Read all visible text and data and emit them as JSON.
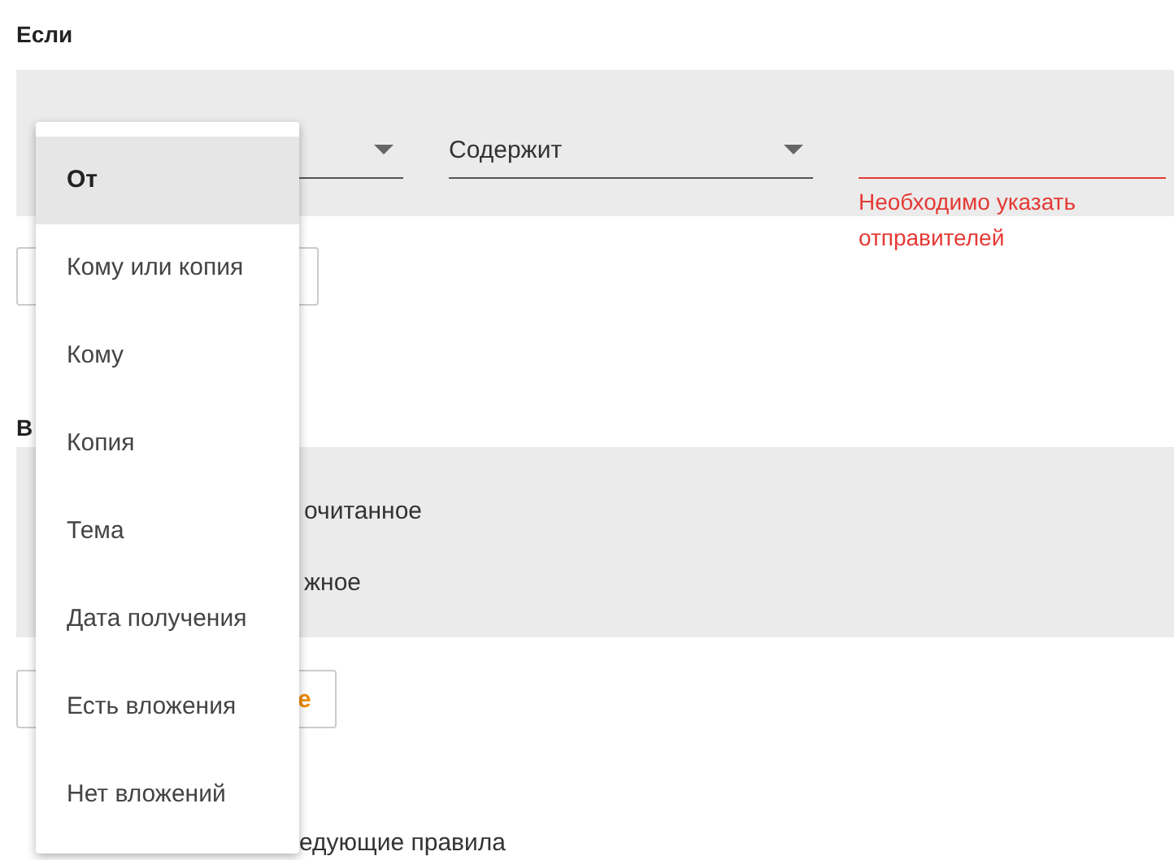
{
  "if_section": {
    "heading": "Если",
    "operator_select": {
      "value": "Содержит"
    },
    "value_field": {
      "error": "Необходимо указать отправителей"
    }
  },
  "actions_section": {
    "heading": "В",
    "actions": [
      {
        "label": "очитанное"
      },
      {
        "label": "жное"
      }
    ],
    "add_button": {
      "label": "е"
    }
  },
  "footer": {
    "text": "едующие правила"
  },
  "field_menu": {
    "items": [
      {
        "label": "От",
        "selected": true
      },
      {
        "label": "Кому или копия",
        "selected": false
      },
      {
        "label": "Кому",
        "selected": false
      },
      {
        "label": "Копия",
        "selected": false
      },
      {
        "label": "Тема",
        "selected": false
      },
      {
        "label": "Дата получения",
        "selected": false
      },
      {
        "label": "Есть вложения",
        "selected": false
      },
      {
        "label": "Нет вложений",
        "selected": false
      }
    ]
  }
}
